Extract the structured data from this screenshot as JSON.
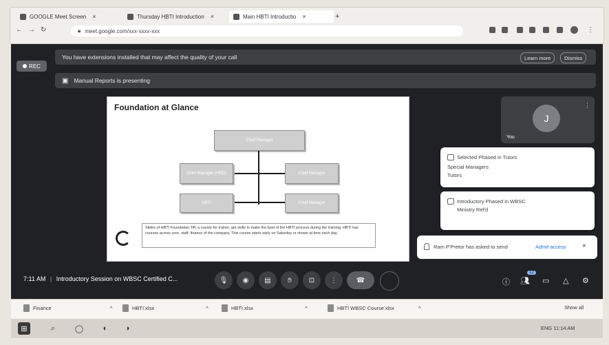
{
  "browser": {
    "tabs": [
      {
        "label": "GOOGLE Meet Screen",
        "active": false
      },
      {
        "label": "Thursday HBTI Introduction",
        "active": false
      },
      {
        "label": "Main HBTI Introductio",
        "active": true
      }
    ],
    "new_tab": "+",
    "url": "meet.google.com/xxx-xxxx-xxx"
  },
  "meet": {
    "rec_badge": "REC",
    "warning": {
      "text": "You have extensions installed that may affect the quality of your call",
      "learn_more": "Learn more",
      "dismiss": "Dismiss"
    },
    "manual_banner": "Manual Reports is presenting",
    "slide": {
      "title": "Foundation at Glance",
      "boxes": [
        "Chief Manager",
        "Chief Manager (HRD)",
        "Chief Manager",
        "HBTI",
        "Chief Manager"
      ],
      "note": "Slides of HBTI Foundation Tiff, a course for trainer, get skills to make the best of the HBTI process during the training. HBTI has courses across core, staff, finance of the company. This course starts early on Saturday or shown at time each day."
    },
    "self_tile": {
      "avatar_initial": "J",
      "name": "You",
      "menu": "⋮"
    },
    "notifications": [
      {
        "title": "Selected Phased in Tutors",
        "line2": "Special Managers",
        "line3": "Tutors"
      },
      {
        "title": "Introductory Phased in WBSC",
        "line2": "Ministry Ref'd",
        "line3": ""
      }
    ],
    "pin_bar": {
      "text": "Ram P'Pretor has asked to send",
      "action": "Admit access",
      "close": "×"
    },
    "time": "7:11 AM",
    "meeting_title": "Introductory Session on WBSC Certified C...",
    "controls": [
      "mic-icon",
      "camera-icon",
      "captions-icon",
      "hand-icon",
      "present-icon",
      "more-icon",
      "end-call-icon",
      "extra-icon"
    ],
    "right_controls": [
      "info-icon",
      "people-icon",
      "chat-icon",
      "activities-icon",
      "host-icon"
    ],
    "people_count": "12"
  },
  "downloads": [
    {
      "name": "Finance",
      "x": "^"
    },
    {
      "name": "HBTI.xlsx",
      "x": "^"
    },
    {
      "name": "HBTI.xlsx",
      "x": "^"
    },
    {
      "name": "HBTI WBSC Course.xlsx",
      "x": "^"
    }
  ],
  "downloads_show_all": "Show all",
  "taskbar": {
    "tray": "ENG 11:14 AM"
  }
}
